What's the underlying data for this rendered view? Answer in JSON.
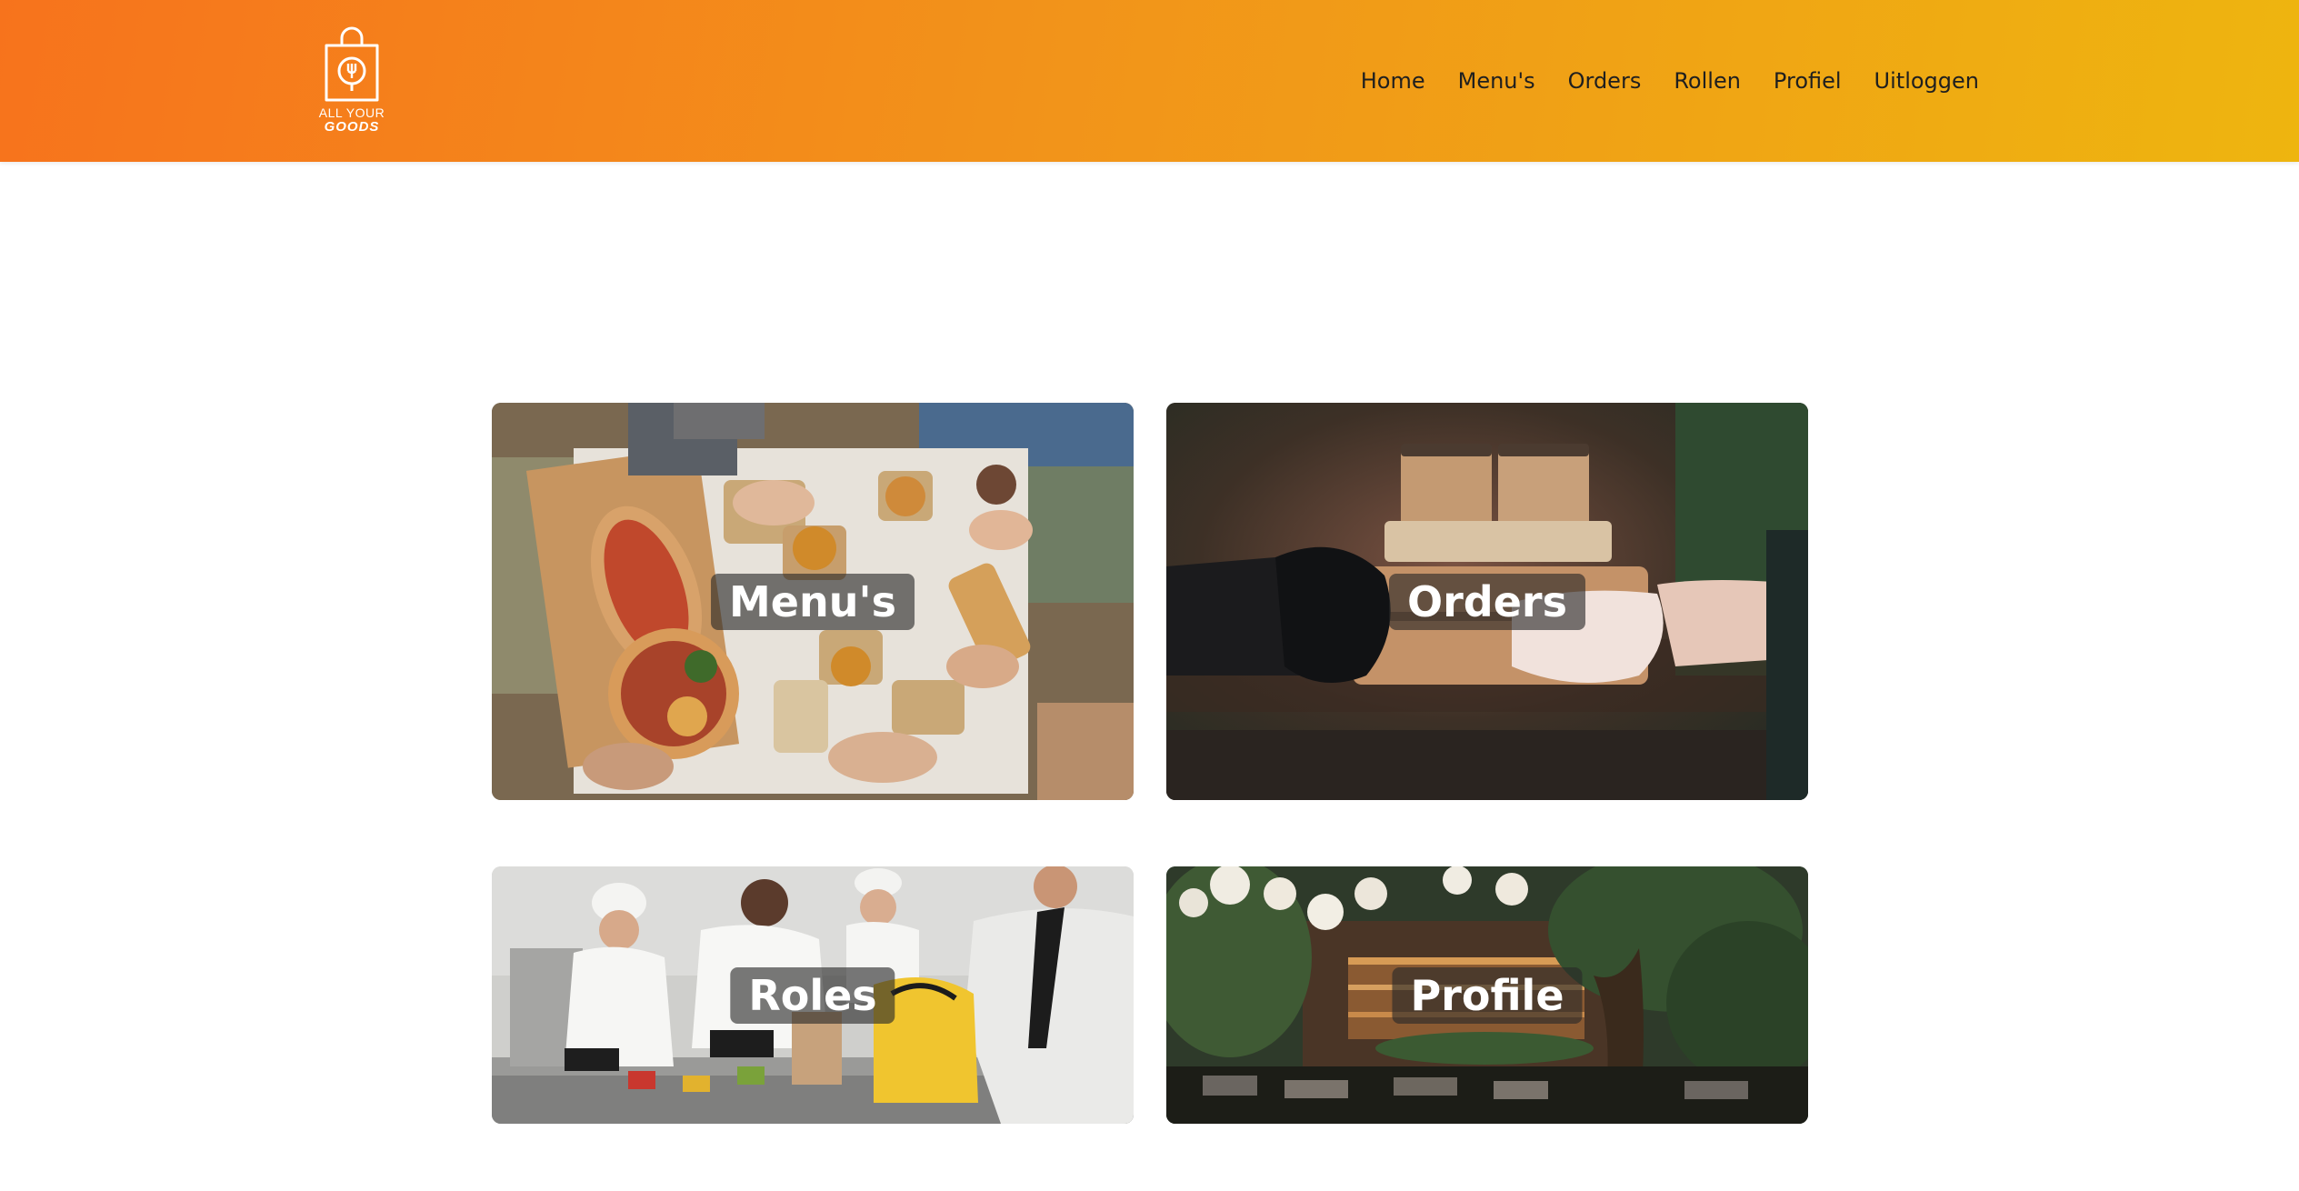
{
  "brand": {
    "logo_line1": "ALL YOUR",
    "logo_line2": "GOODS",
    "logo_icon": "shopping-bag-fork-icon"
  },
  "nav": {
    "items": [
      {
        "label": "Home"
      },
      {
        "label": "Menu's"
      },
      {
        "label": "Orders"
      },
      {
        "label": "Rollen"
      },
      {
        "label": "Profiel"
      },
      {
        "label": "Uitloggen"
      }
    ]
  },
  "cards": [
    {
      "label": "Menu's",
      "image": "food-table-photo"
    },
    {
      "label": "Orders",
      "image": "delivery-handover-photo"
    },
    {
      "label": "Roles",
      "image": "kitchen-staff-photo"
    },
    {
      "label": "Profile",
      "image": "restaurant-terrace-photo"
    }
  ],
  "colors": {
    "header_gradient_start": "#f7731c",
    "header_gradient_end": "#eeb50f",
    "label_background": "rgba(40,40,40,0.62)",
    "label_text": "#ffffff"
  }
}
